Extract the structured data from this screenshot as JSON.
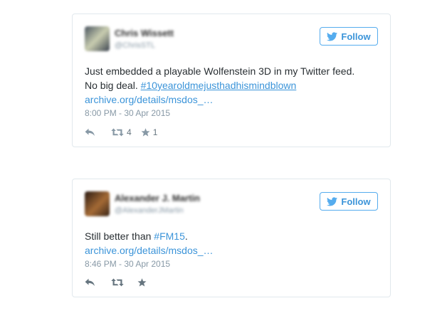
{
  "tweets": [
    {
      "name": "Chris Wissett",
      "handle": "@ChrisSTL",
      "follow_label": "Follow",
      "text_before": "Just embedded a playable Wolfenstein 3D in my Twitter feed. No big deal. ",
      "hashtag": "#10yearoldmejusthadhismindblown",
      "link": "archive.org/details/msdos_…",
      "timestamp": "8:00 PM - 30 Apr 2015",
      "retweet_count": "4",
      "favorite_count": "1"
    },
    {
      "name": "Alexander J. Martin",
      "handle": "@AlexanderJMartin",
      "follow_label": "Follow",
      "text_before": "Still better than ",
      "hashtag": "#FM15",
      "hashtag_after": ".",
      "link": "archive.org/details/msdos_…",
      "timestamp": "8:46 PM - 30 Apr 2015"
    }
  ],
  "colors": {
    "accent": "#3b94d9",
    "border": "#e1e8ed",
    "meta": "#8899a6",
    "text": "#292f33"
  },
  "icons": [
    "twitter-bird-icon",
    "reply-icon",
    "retweet-icon",
    "favorite-star-icon"
  ]
}
